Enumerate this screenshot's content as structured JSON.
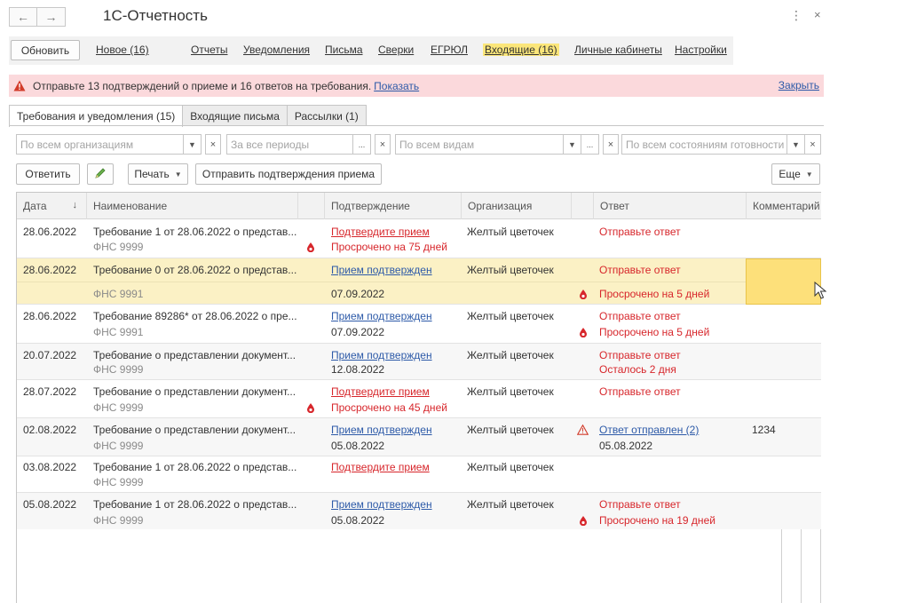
{
  "window": {
    "title": "1С-Отчетность",
    "more_glyph": "⋮",
    "close_glyph": "×",
    "back_glyph": "←",
    "forward_glyph": "→"
  },
  "menu": {
    "refresh_label": "Обновить",
    "items": [
      {
        "label": "Новое (16)"
      },
      {
        "label": "Отчеты"
      },
      {
        "label": "Уведомления"
      },
      {
        "label": "Письма"
      },
      {
        "label": "Сверки"
      },
      {
        "label": "ЕГРЮЛ"
      },
      {
        "label": "Входящие (16)",
        "active": true
      },
      {
        "label": "Личные кабинеты"
      },
      {
        "label": "Настройки"
      }
    ]
  },
  "banner": {
    "text": "Отправьте 13 подтверждений о приеме и 16 ответов на требования.",
    "link": "Показать",
    "close": "Закрыть",
    "icon": "warning-icon"
  },
  "tabs": [
    {
      "label": "Требования и уведомления (15)",
      "active": true
    },
    {
      "label": "Входящие письма"
    },
    {
      "label": "Рассылки (1)"
    }
  ],
  "filters": {
    "organizations": "По всем организациям",
    "periods": "За все периоды",
    "kinds": "По всем видам",
    "states": "По всем состояниям готовности"
  },
  "toolbar": {
    "reply": "Ответить",
    "print": "Печать",
    "send_confirmations": "Отправить подтверждения приема",
    "more": "Еще"
  },
  "table": {
    "columns": {
      "date": "Дата",
      "name": "Наименование",
      "confirmation": "Подтверждение",
      "organization": "Организация",
      "answer": "Ответ",
      "comment": "Комментарий"
    },
    "sort_glyph": "↓",
    "rows": [
      {
        "date": "28.06.2022",
        "name": "Требование 1 от 28.06.2022 о представ...",
        "sub": "ФНС 9999",
        "confirm1": "Подтвердите прием",
        "confirm2": "Просрочено на 75 дней",
        "org": "Желтый цветочек",
        "ans1": "Отправьте ответ",
        "ans2": "",
        "comment": ""
      },
      {
        "date": "28.06.2022",
        "name": "Требование 0 от 28.06.2022 о представ...",
        "sub": "ФНС 9991",
        "confirm1": "Прием подтвержден",
        "confirm2": "07.09.2022",
        "org": "Желтый цветочек",
        "ans1": "Отправьте ответ",
        "ans2": "Просрочено на 5 дней",
        "comment": ""
      },
      {
        "date": "28.06.2022",
        "name": "Требование 89286* от 28.06.2022 о пре...",
        "sub": "ФНС 9991",
        "confirm1": "Прием подтвержден",
        "confirm2": "07.09.2022",
        "org": "Желтый цветочек",
        "ans1": "Отправьте ответ",
        "ans2": "Просрочено на 5 дней",
        "comment": ""
      },
      {
        "date": "20.07.2022",
        "name": "Требование о представлении документ...",
        "sub": "ФНС 9999",
        "confirm1": "Прием подтвержден",
        "confirm2": "12.08.2022",
        "org": "Желтый цветочек",
        "ans1": "Отправьте ответ",
        "ans2": "Осталось 2 дня",
        "comment": ""
      },
      {
        "date": "28.07.2022",
        "name": "Требование о представлении документ...",
        "sub": "ФНС 9999",
        "confirm1": "Подтвердите прием",
        "confirm2": "Просрочено на 45 дней",
        "org": "Желтый цветочек",
        "ans1": "Отправьте ответ",
        "ans2": "",
        "comment": ""
      },
      {
        "date": "02.08.2022",
        "name": "Требование о представлении документ...",
        "sub": "ФНС 9999",
        "confirm1": "Прием подтвержден",
        "confirm2": "05.08.2022",
        "org": "Желтый цветочек",
        "ans1": "Ответ отправлен (2)",
        "ans2": "05.08.2022",
        "comment": "1234"
      },
      {
        "date": "03.08.2022",
        "name": "Требование 1 от 28.06.2022 о представ...",
        "sub": "ФНС 9999",
        "confirm1": "Подтвердите прием",
        "confirm2": "",
        "org": "Желтый цветочек",
        "ans1": "",
        "ans2": "",
        "comment": ""
      },
      {
        "date": "05.08.2022",
        "name": "Требование 1 от 28.06.2022 о представ...",
        "sub": "ФНС 9999",
        "confirm1": "Прием подтвержден",
        "confirm2": "05.08.2022",
        "org": "Желтый цветочек",
        "ans1": "Отправьте ответ",
        "ans2": "Просрочено на 19 дней",
        "comment": ""
      }
    ]
  },
  "colors": {
    "accent_yellow": "#fbe67a",
    "banner_pink": "#fbd9dc",
    "link_blue": "#2d5aa8",
    "alert_red": "#d7262b",
    "selection": "#fbf1c5"
  }
}
